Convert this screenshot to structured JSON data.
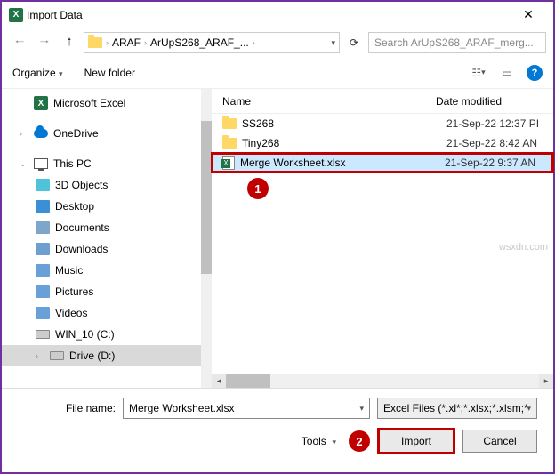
{
  "window": {
    "title": "Import Data"
  },
  "nav": {
    "breadcrumb": {
      "seg1": "ARAF",
      "seg2": "ArUpS268_ARAF_..."
    },
    "search_placeholder": "Search ArUpS268_ARAF_merg..."
  },
  "toolbar": {
    "organize": "Organize",
    "newfolder": "New folder"
  },
  "columns": {
    "name": "Name",
    "date": "Date modified"
  },
  "sidebar": {
    "items": [
      {
        "label": "Microsoft Excel"
      },
      {
        "label": "OneDrive"
      },
      {
        "label": "This PC"
      },
      {
        "label": "3D Objects"
      },
      {
        "label": "Desktop"
      },
      {
        "label": "Documents"
      },
      {
        "label": "Downloads"
      },
      {
        "label": "Music"
      },
      {
        "label": "Pictures"
      },
      {
        "label": "Videos"
      },
      {
        "label": "WIN_10 (C:)"
      },
      {
        "label": "Drive (D:)"
      }
    ]
  },
  "files": [
    {
      "name": "SS268",
      "date": "21-Sep-22 12:37 PI"
    },
    {
      "name": "Tiny268",
      "date": "21-Sep-22 8:42 AN"
    },
    {
      "name": "Merge Worksheet.xlsx",
      "date": "21-Sep-22 9:37 AN"
    }
  ],
  "bottom": {
    "filename_label": "File name:",
    "filename_value": "Merge Worksheet.xlsx",
    "filter": "Excel Files (*.xl*;*.xlsx;*.xlsm;*.x",
    "tools": "Tools",
    "import": "Import",
    "cancel": "Cancel"
  },
  "callouts": {
    "c1": "1",
    "c2": "2"
  },
  "watermark": "wsxdn.com"
}
